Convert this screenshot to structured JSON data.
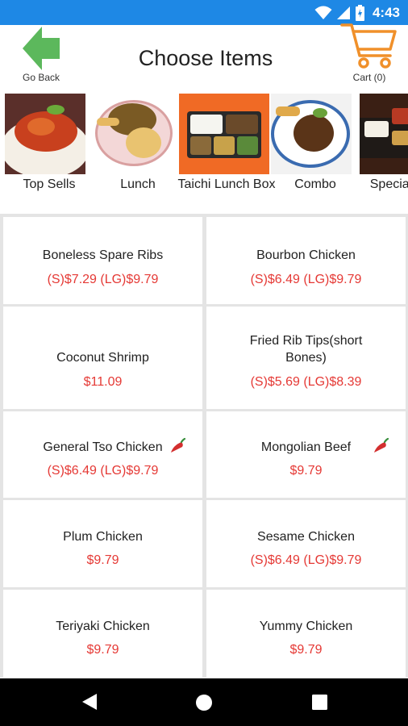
{
  "status_bar": {
    "time": "4:43"
  },
  "header": {
    "back_label": "Go Back",
    "title": "Choose Items",
    "cart_label": "Cart (0)"
  },
  "categories": [
    {
      "label": "Top Sells"
    },
    {
      "label": "Lunch"
    },
    {
      "label": "Taichi Lunch Box"
    },
    {
      "label": "Combo"
    },
    {
      "label": "Special Box"
    }
  ],
  "menu_items": [
    {
      "name": "Boneless Spare Ribs",
      "price": "(S)$7.29 (LG)$9.79",
      "spicy": false
    },
    {
      "name": "Bourbon Chicken",
      "price": "(S)$6.49 (LG)$9.79",
      "spicy": false
    },
    {
      "name": "Coconut Shrimp",
      "price": "$11.09",
      "spicy": false
    },
    {
      "name": "Fried Rib Tips(short Bones)",
      "price": "(S)$5.69 (LG)$8.39",
      "spicy": false
    },
    {
      "name": "General Tso Chicken",
      "price": "(S)$6.49 (LG)$9.79",
      "spicy": true
    },
    {
      "name": "Mongolian Beef",
      "price": "$9.79",
      "spicy": true
    },
    {
      "name": "Plum Chicken",
      "price": "$9.79",
      "spicy": false
    },
    {
      "name": "Sesame Chicken",
      "price": "(S)$6.49 (LG)$9.79",
      "spicy": false
    },
    {
      "name": "Teriyaki Chicken",
      "price": "$9.79",
      "spicy": false
    },
    {
      "name": "Yummy Chicken",
      "price": "$9.79",
      "spicy": false
    }
  ],
  "colors": {
    "status_bar": "#1e88e5",
    "back_arrow": "#5cb85c",
    "cart": "#f0902a",
    "price": "#e53935",
    "grid_gap": "#e4e4e4",
    "nav_bar": "#000000"
  }
}
